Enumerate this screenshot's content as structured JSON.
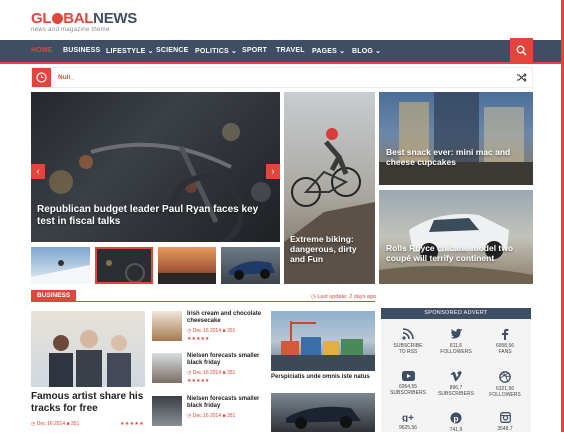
{
  "brand": {
    "logo_part1": "GL",
    "logo_part2": "BAL",
    "logo_part3": "NEWS",
    "tagline": "news and magazine theme",
    "accent": "#e2453c",
    "nav_color": "#3e4e64"
  },
  "nav": {
    "items": [
      {
        "label": "HOME",
        "active": true
      },
      {
        "label": "BUSINESS"
      },
      {
        "label": "LIFESTYLE ⌄"
      },
      {
        "label": "SCIENCE"
      },
      {
        "label": "POLITICS ⌄"
      },
      {
        "label": "SPORT"
      },
      {
        "label": "TRAVEL"
      },
      {
        "label": "PAGES ⌄"
      },
      {
        "label": "BLOG ⌄"
      }
    ],
    "search_icon": "search-icon"
  },
  "ticker": {
    "text": "Null_",
    "icon": "clock-icon",
    "shuffle_icon": "shuffle-icon"
  },
  "slider": {
    "main_caption": "Republican budget leader Paul Ryan faces key test in fiscal talks",
    "prev_icon": "chevron-left-icon",
    "next_icon": "chevron-right-icon"
  },
  "tiles": {
    "cyclist_caption": "Extreme biking: dangerous, dirty and Fun",
    "snack_caption": "Best snack ever: mini mac and cheese cupcakes",
    "car_caption": "Rolls Royce chicane model two coupé will terrify continent"
  },
  "business": {
    "section_label": "BUSINESS",
    "last_update": "Last update: 2 days ago",
    "featured_title": "Famous artist share his tracks for free",
    "featured_date": "Dec 16 2014",
    "featured_comments": "351",
    "posts": [
      {
        "title": "Irish cream and chocolate cheesecake",
        "date": "Dec 16 2014",
        "comments": "351"
      },
      {
        "title": "Nielsen forecasts smaller black friday",
        "date": "Dec 16 2014",
        "comments": "351"
      },
      {
        "title": "Nielsen forecasts smaller black friday",
        "date": "Dec 16 2014",
        "comments": "351"
      }
    ],
    "side_caption": "Perspiciatis unde omnis iste natus",
    "stars": "★★★★★"
  },
  "sponsored": {
    "header": "SPONSORED ADVERT",
    "items": [
      {
        "icon": "rss-icon",
        "num": "SUBSCRIBE",
        "label": "TO RSS"
      },
      {
        "icon": "twitter-icon",
        "num": "811,6",
        "label": "FOLLOWERS"
      },
      {
        "icon": "facebook-icon",
        "num": "6958,56",
        "label": "FANS"
      },
      {
        "icon": "youtube-icon",
        "num": "6954,55",
        "label": "SUBSCRIBERS"
      },
      {
        "icon": "vimeo-icon",
        "num": "896,7",
        "label": "SUBSCRIBERS"
      },
      {
        "icon": "dribbble-icon",
        "num": "6321,56",
        "label": "FOLLOWERS"
      },
      {
        "icon": "google-plus-icon",
        "num": "9625,56",
        "label": ""
      },
      {
        "icon": "pinterest-icon",
        "num": "741,9",
        "label": ""
      },
      {
        "icon": "instagram-icon",
        "num": "3548,7",
        "label": ""
      }
    ]
  }
}
